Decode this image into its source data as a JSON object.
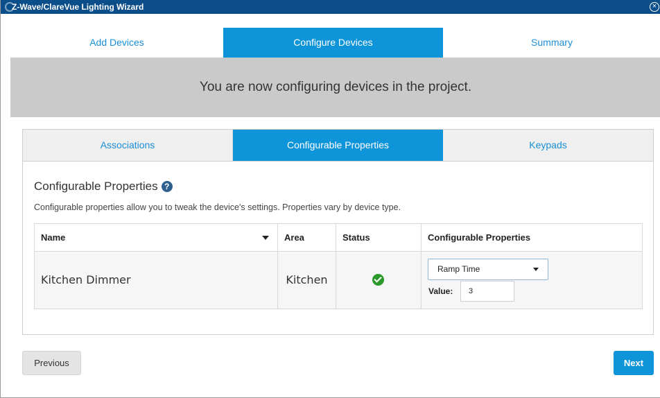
{
  "window": {
    "title": "Z-Wave/ClareVue Lighting Wizard",
    "close_icon": "close-circle-icon"
  },
  "wizard_tabs": [
    {
      "label": "Add Devices",
      "active": false
    },
    {
      "label": "Configure Devices",
      "active": true
    },
    {
      "label": "Summary",
      "active": false
    }
  ],
  "banner": {
    "text": "You are now configuring devices in the project."
  },
  "sub_tabs": [
    {
      "label": "Associations",
      "active": false
    },
    {
      "label": "Configurable Properties",
      "active": true
    },
    {
      "label": "Keypads",
      "active": false
    }
  ],
  "section": {
    "title": "Configurable Properties",
    "help_icon": "question-circle-icon",
    "description": "Configurable properties allow you to tweak the device's settings. Properties vary by device type."
  },
  "table": {
    "columns": [
      "Name",
      "Area",
      "Status",
      "Configurable Properties"
    ],
    "rows": [
      {
        "name": "Kitchen Dimmer",
        "area": "Kitchen",
        "status": "ok",
        "property_select": "Ramp Time",
        "value_label": "Value:",
        "value": "3"
      }
    ]
  },
  "buttons": {
    "previous": "Previous",
    "next": "Next"
  },
  "colors": {
    "accent": "#0e94d9",
    "titlebar": "#0b4e8a",
    "banner": "#cacaca",
    "status_ok": "#2b9a2b"
  }
}
